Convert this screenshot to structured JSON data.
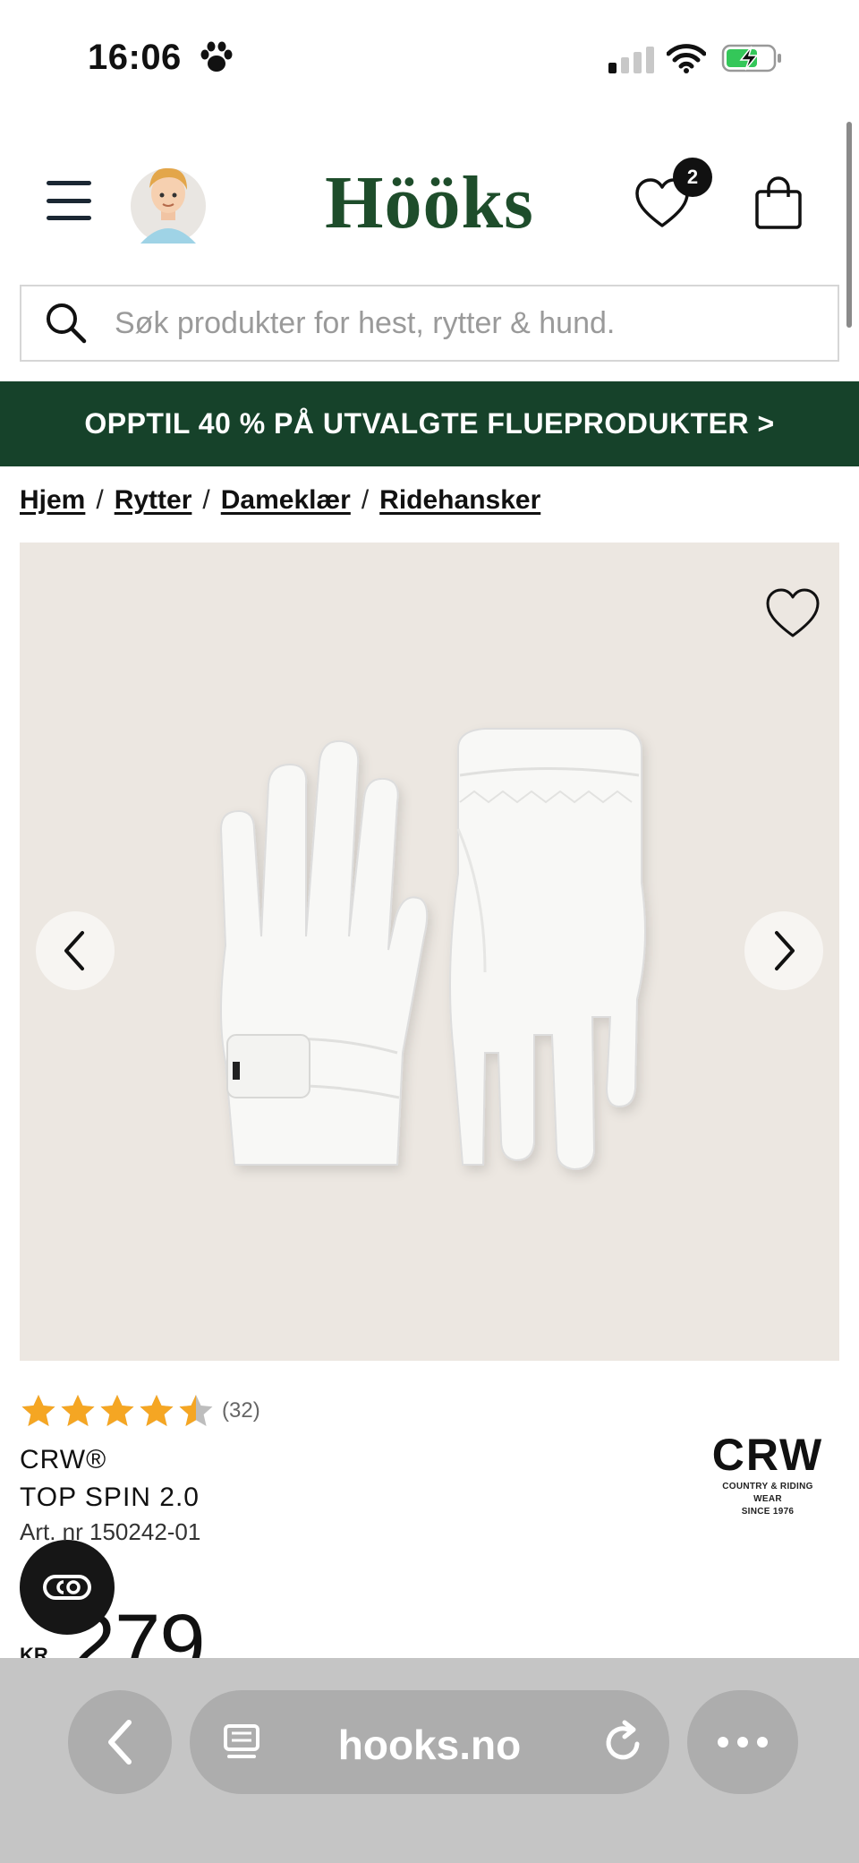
{
  "status_bar": {
    "time": "16:06"
  },
  "header": {
    "logo": "Hööks",
    "wishlist_count": "2"
  },
  "search": {
    "placeholder": "Søk produkter for hest, rytter & hund."
  },
  "promo": {
    "text": "OPPTIL 40 % PÅ UTVALGTE FLUEPRODUKTER >"
  },
  "breadcrumb": {
    "items": [
      "Hjem",
      "Rytter",
      "Dameklær",
      "Ridehansker"
    ],
    "separator": "/"
  },
  "product": {
    "rating": 4.5,
    "rating_count": "(32)",
    "brand": "CRW®",
    "name": "TOP SPIN 2.0",
    "article_number": "Art. nr 150242-01",
    "currency": "KR",
    "price": "279",
    "brand_logo": {
      "mark": "CRW",
      "sub1": "COUNTRY & RIDING WEAR",
      "sub2": "SINCE 1976"
    }
  },
  "browser": {
    "host": "hooks.no"
  },
  "colors": {
    "brand_green": "#1e4d2b",
    "promo_bg": "#16422a",
    "star": "#f5a623"
  }
}
